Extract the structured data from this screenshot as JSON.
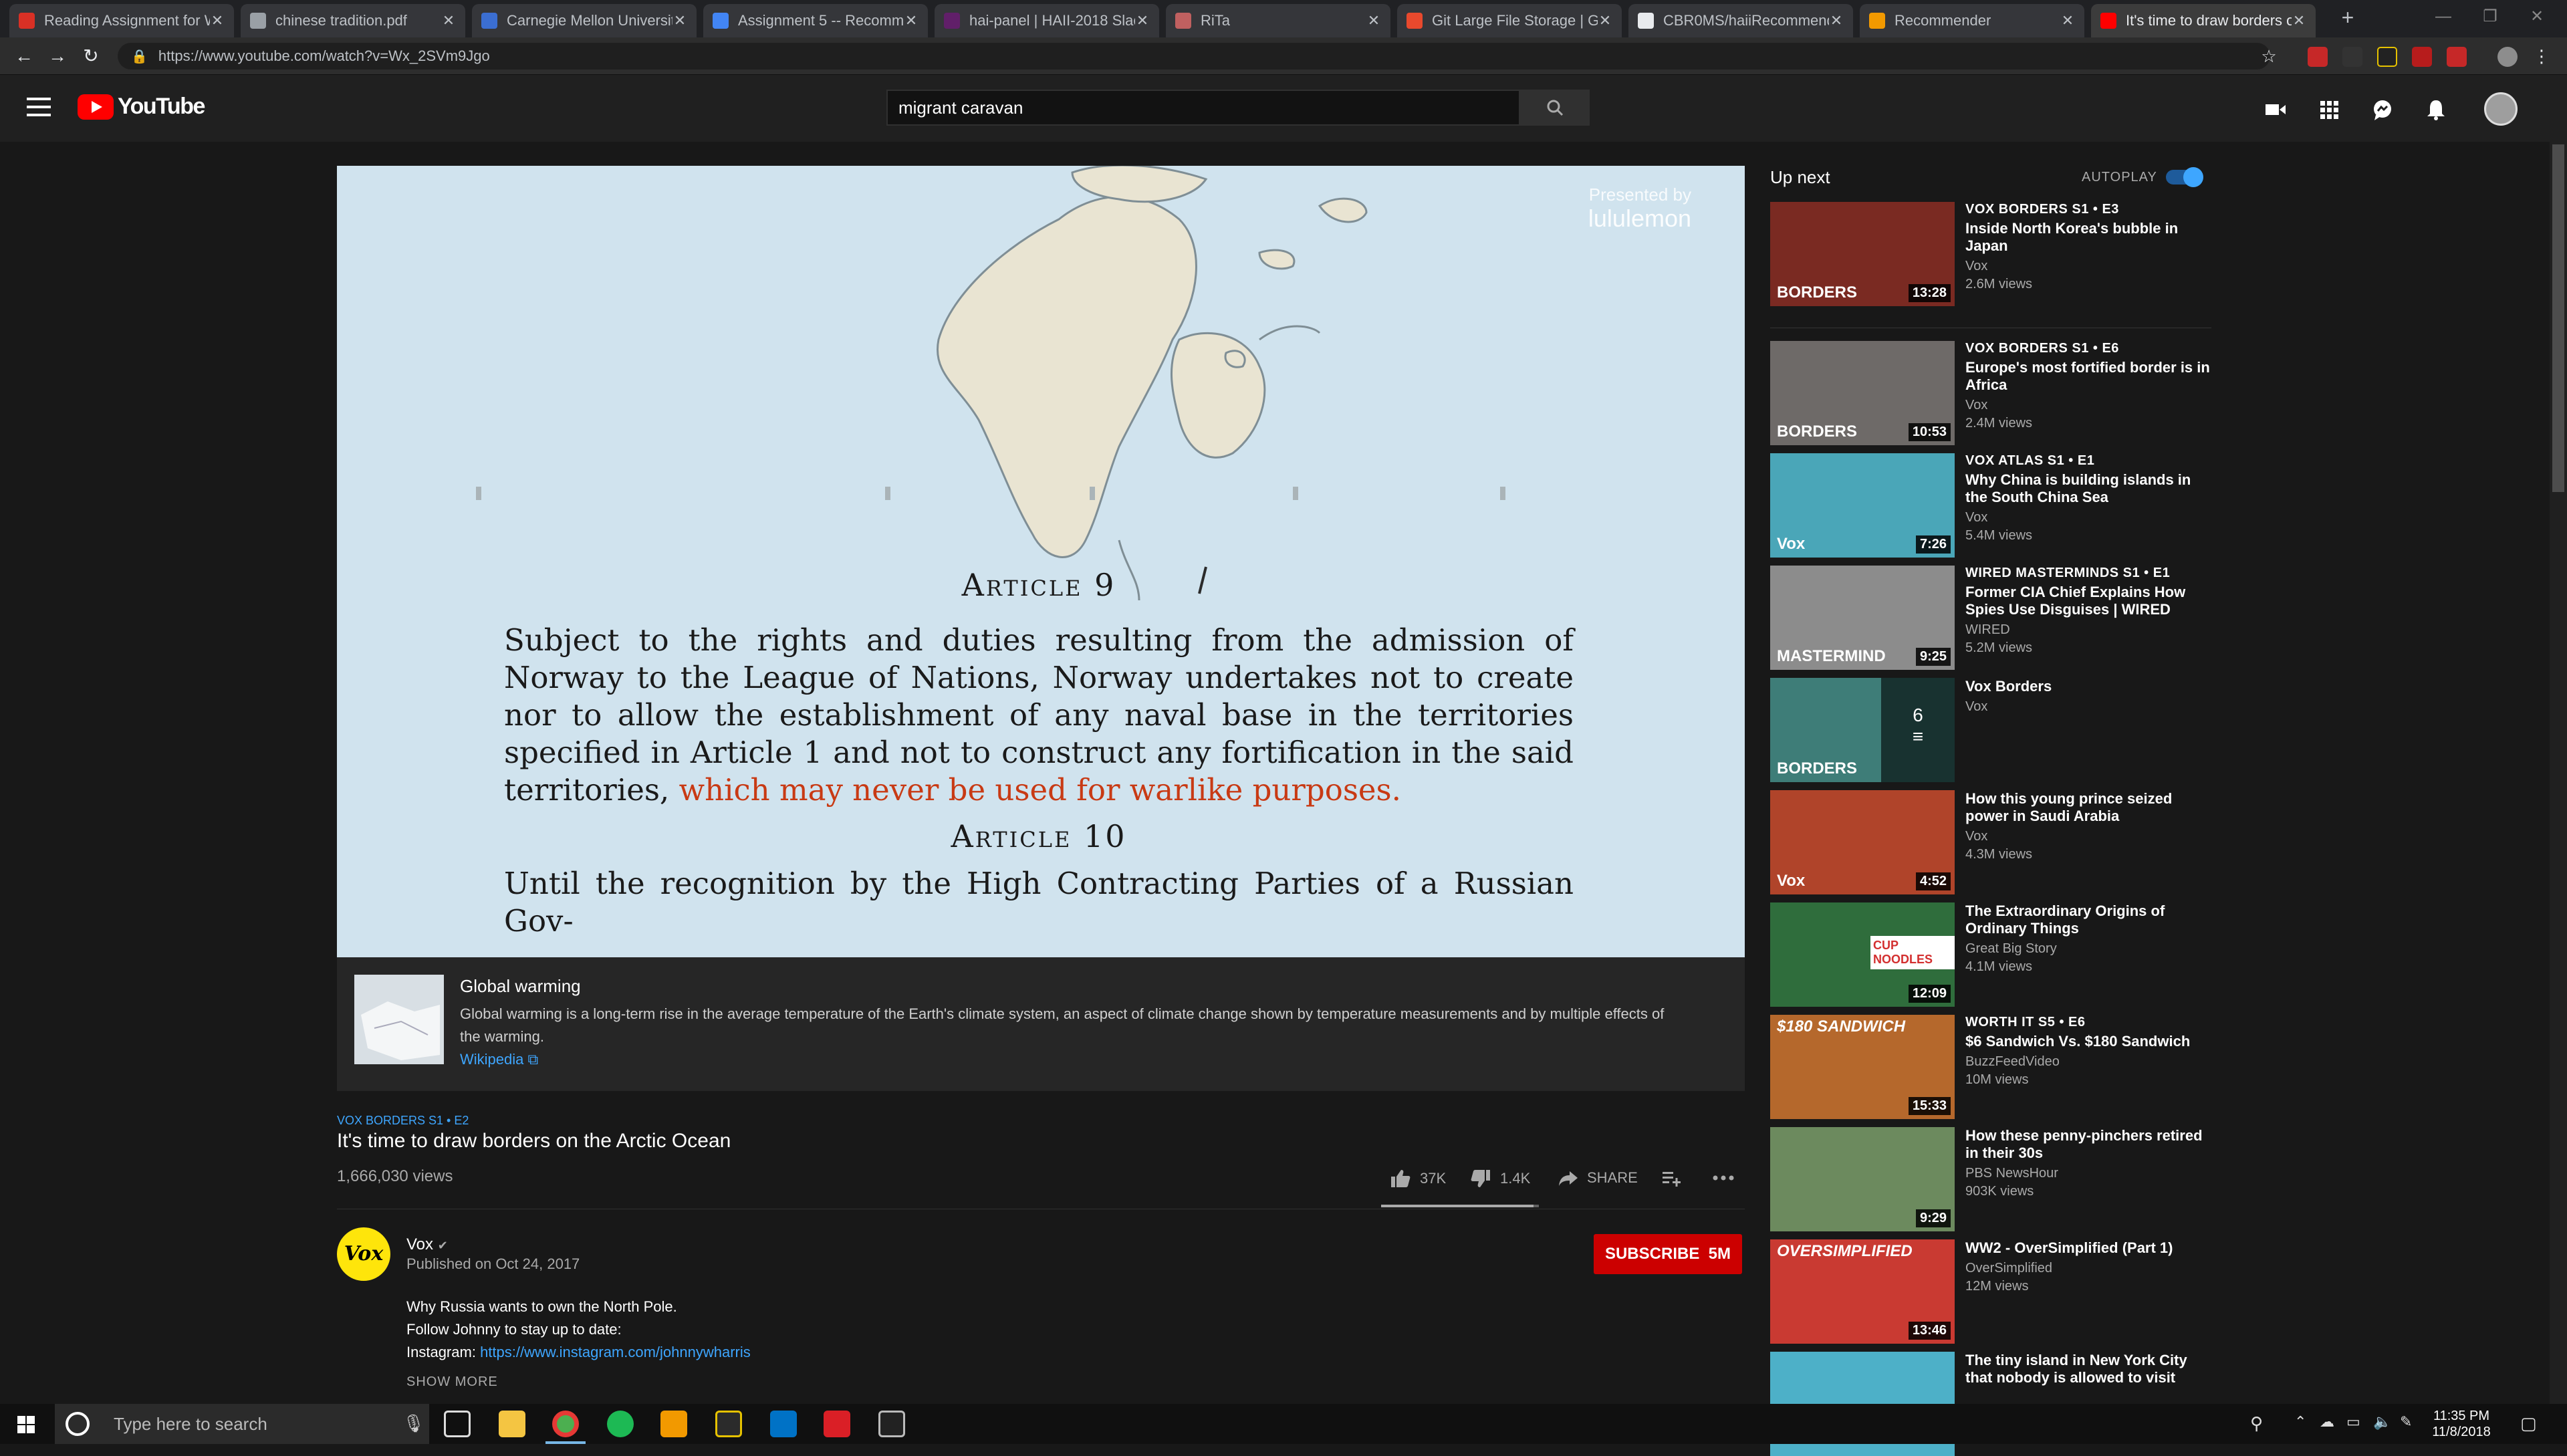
{
  "browser": {
    "tabs": [
      {
        "title": "Reading Assignment for W",
        "color": "#d93025"
      },
      {
        "title": "chinese tradition.pdf",
        "color": "#9aa0a6"
      },
      {
        "title": "Carnegie Mellon University",
        "color": "#3b6ed1"
      },
      {
        "title": "Assignment 5 -- Recommen",
        "color": "#4285f4"
      },
      {
        "title": "hai-panel | HAII-2018 Slack",
        "color": "#611f69"
      },
      {
        "title": "RiTa",
        "color": "#c06060"
      },
      {
        "title": "Git Large File Storage | Git",
        "color": "#e8492d"
      },
      {
        "title": "CBR0MS/haiiRecommende",
        "color": "#e8eaed"
      },
      {
        "title": "Recommender",
        "color": "#f29900"
      },
      {
        "title": "It's time to draw borders o",
        "color": "#ff0000"
      }
    ],
    "new_tab": "+",
    "url": "https://www.youtube.com/watch?v=Wx_2SVm9Jgo"
  },
  "youtube": {
    "logo_text": "YouTube",
    "search_value": "migrant caravan"
  },
  "player": {
    "presented_by": "Presented by",
    "sponsor": "lululemon",
    "article9_heading": "Article 9",
    "article9_text": "Subject to the rights and duties resulting from the admission of Norway to the League of Nations, Norway undertakes not to create nor to allow the establishment of any naval base in the territories specified in Article 1 and not to construct any fortification in the said territories,",
    "article9_highlight": "which may never be used for warlike purposes.",
    "article10_heading": "Article 10",
    "article10_text": "Until the recognition by the High Contracting Parties of a Russian Gov-"
  },
  "knowledge_panel": {
    "title": "Global warming",
    "description": "Global warming is a long-term rise in the average temperature of the Earth's climate system, an aspect of climate change shown by temperature measurements and by multiple effects of the warming.",
    "link": "Wikipedia"
  },
  "video": {
    "series": "VOX BORDERS  S1 • E2",
    "title": "It's time to draw borders on the Arctic Ocean",
    "views": "1,666,030 views",
    "likes": "37K",
    "dislikes": "1.4K",
    "share": "SHARE",
    "like_ratio": 0.964
  },
  "channel": {
    "avatar_text": "Vox",
    "name": "Vox",
    "published": "Published on Oct 24, 2017",
    "subscribe_label": "SUBSCRIBE",
    "subscriber_count": "5M"
  },
  "description": {
    "line1": "Why Russia wants to own the North Pole.",
    "line2": "Follow Johnny to stay up to date:",
    "line3_label": "Instagram:",
    "line3_link": "https://www.instagram.com/johnnywharris",
    "show_more": "SHOW MORE"
  },
  "sidebar": {
    "up_next": "Up next",
    "autoplay": "AUTOPLAY",
    "autoplay_on": true,
    "items": [
      {
        "series": "VOX BORDERS  S1 • E3",
        "title": "Inside North Korea's bubble in Japan",
        "channel": "Vox",
        "views": "2.6M views",
        "duration": "13:28",
        "thumb_text": "BORDERS",
        "bg": "#7a2a22"
      },
      {
        "series": "VOX BORDERS  S1 • E6",
        "title": "Europe's most fortified border is in Africa",
        "channel": "Vox",
        "views": "2.4M views",
        "duration": "10:53",
        "thumb_text": "BORDERS",
        "bg": "#6e6a68"
      },
      {
        "series": "VOX ATLAS  S1 • E1",
        "title": "Why China is building islands in the South China Sea",
        "channel": "Vox",
        "views": "5.4M views",
        "duration": "7:26",
        "thumb_text": "Vox",
        "bg": "#4aa6b8"
      },
      {
        "series": "WIRED MASTERMINDS  S1 • E1",
        "title": "Former CIA Chief Explains How Spies Use Disguises | WIRED",
        "channel": "WIRED",
        "views": "5.2M views",
        "duration": "9:25",
        "thumb_text": "MASTERMIND",
        "bg": "#8c8c8c"
      },
      {
        "series": "",
        "title": "Vox Borders",
        "channel": "Vox",
        "views": "",
        "duration": "",
        "playlist_count": "6",
        "thumb_text": "BORDERS",
        "bg": "#3e7d78"
      },
      {
        "series": "",
        "title": "How this young prince seized power in Saudi Arabia",
        "channel": "Vox",
        "views": "4.3M views",
        "duration": "4:52",
        "thumb_text": "Vox",
        "bg": "#b0442a"
      },
      {
        "series": "",
        "title": "The Extraordinary Origins of Ordinary Things",
        "channel": "Great Big Story",
        "views": "4.1M views",
        "duration": "12:09",
        "thumb_text": "CUP NOODLES",
        "bg": "#2f6d3c"
      },
      {
        "series": "WORTH IT  S5 • E6",
        "title": "$6 Sandwich Vs. $180 Sandwich",
        "channel": "BuzzFeedVideo",
        "views": "10M views",
        "duration": "15:33",
        "thumb_text": "$180 SANDWICH",
        "bg": "#b5682c"
      },
      {
        "series": "",
        "title": "How these penny-pinchers retired in their 30s",
        "channel": "PBS NewsHour",
        "views": "903K views",
        "duration": "9:29",
        "thumb_text": "",
        "bg": "#6c8a5e"
      },
      {
        "series": "",
        "title": "WW2 - OverSimplified (Part 1)",
        "channel": "OverSimplified",
        "views": "12M views",
        "duration": "13:46",
        "thumb_text": "OVERSIMPLIFIED",
        "bg": "#c93a32"
      },
      {
        "series": "",
        "title": "The tiny island in New York City that nobody is allowed to visit",
        "channel": "",
        "views": "",
        "duration": "",
        "thumb_text": "",
        "bg": "#4db0c8"
      }
    ]
  },
  "taskbar": {
    "search_placeholder": "Type here to search",
    "time": "11:35 PM",
    "date": "11/8/2018"
  }
}
